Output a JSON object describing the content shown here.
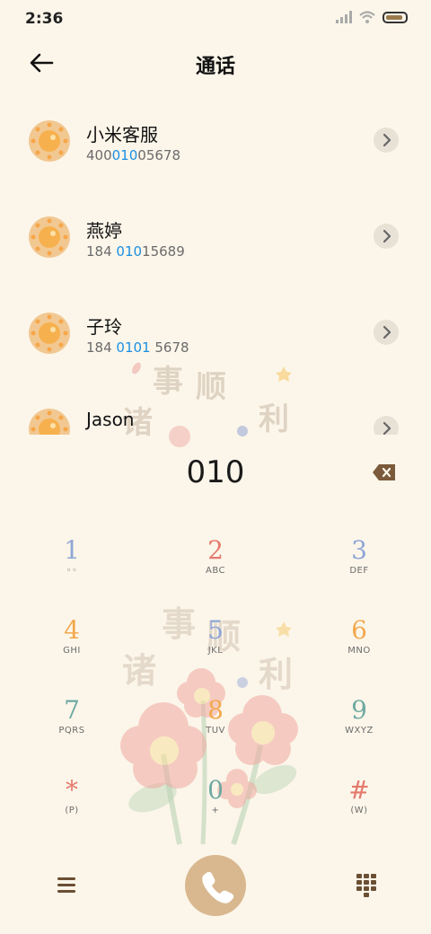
{
  "status_bar": {
    "time": "2:36"
  },
  "header": {
    "title": "通话"
  },
  "contacts": [
    {
      "name": "小米客服",
      "num_pre": "400",
      "num_hl": "010",
      "num_post": "05678"
    },
    {
      "name": "燕婷",
      "num_pre": "184 ",
      "num_hl": "010",
      "num_post": "15689"
    },
    {
      "name": "子玲",
      "num_pre": "184 ",
      "num_hl": "0101",
      "num_post": " 5678"
    },
    {
      "name": "Jason",
      "num_pre": "",
      "num_hl": "",
      "num_post": ""
    }
  ],
  "dialer": {
    "number": "010"
  },
  "keypad": {
    "keys": [
      {
        "digit": "1",
        "letters": "◦◦",
        "color": "#8FA6D6"
      },
      {
        "digit": "2",
        "letters": "ABC",
        "color": "#E57A6E"
      },
      {
        "digit": "3",
        "letters": "DEF",
        "color": "#8FA6D6"
      },
      {
        "digit": "4",
        "letters": "GHI",
        "color": "#F2A94E"
      },
      {
        "digit": "5",
        "letters": "JKL",
        "color": "#8FA6D6"
      },
      {
        "digit": "6",
        "letters": "MNO",
        "color": "#F2A94E"
      },
      {
        "digit": "7",
        "letters": "PQRS",
        "color": "#6FA9A2"
      },
      {
        "digit": "8",
        "letters": "TUV",
        "color": "#F2A94E"
      },
      {
        "digit": "9",
        "letters": "WXYZ",
        "color": "#6FA9A2"
      },
      {
        "digit": "*",
        "letters": "(P)",
        "color": "#E57A6E"
      },
      {
        "digit": "0",
        "letters": "+",
        "color": "#6FA9A2"
      },
      {
        "digit": "#",
        "letters": "(W)",
        "color": "#E57A6E"
      }
    ]
  },
  "colors": {
    "background": "#FCF6EA",
    "highlight": "#1a8fe3",
    "call_button": "#D9B890",
    "icon_brown": "#7a5a3a"
  },
  "icons": [
    "back-arrow-icon",
    "chevron-right-icon",
    "backspace-icon",
    "menu-icon",
    "phone-icon",
    "dialpad-icon"
  ]
}
